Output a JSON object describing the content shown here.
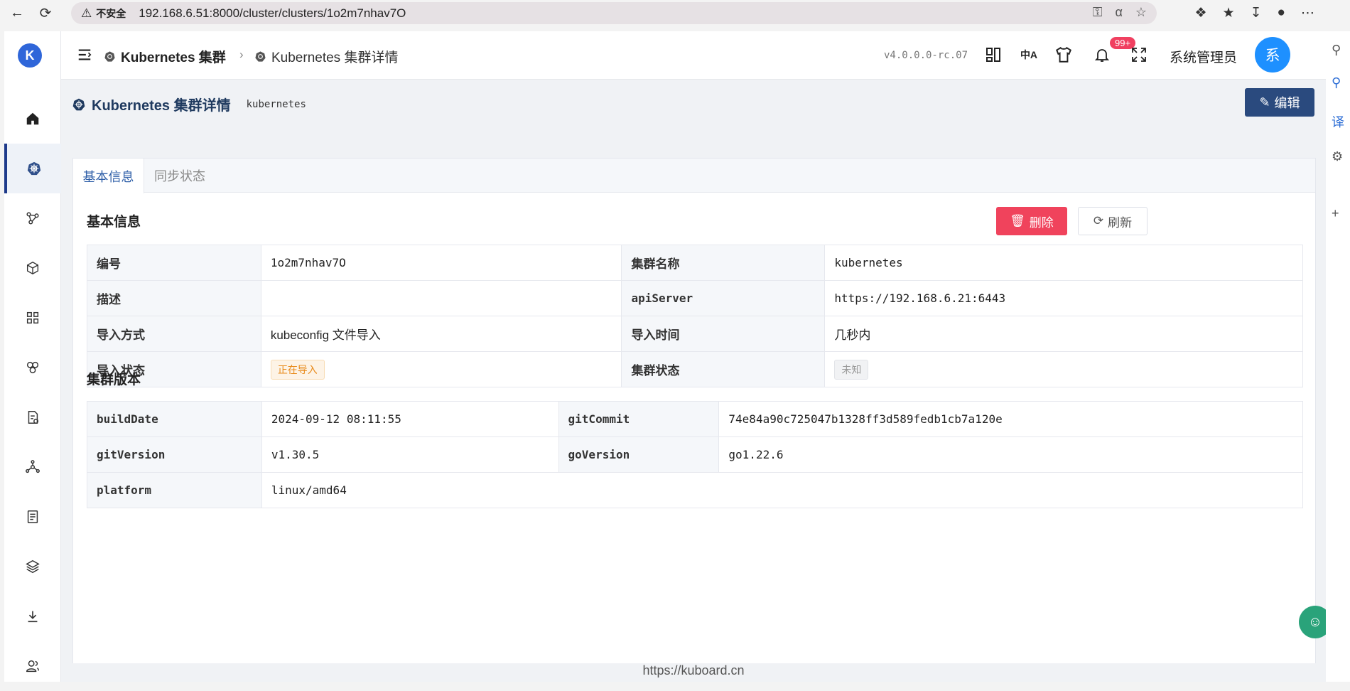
{
  "browser": {
    "insecure_label": "不安全",
    "url": "192.168.6.51:8000/cluster/clusters/1o2m7nhav7O"
  },
  "header": {
    "breadcrumb_1": "Kubernetes 集群",
    "breadcrumb_2": "Kubernetes 集群详情",
    "version": "v4.0.0.0-rc.07",
    "notification_badge": "99+",
    "username": "系统管理员",
    "avatar_letter": "系"
  },
  "sidebar": {
    "logo_letter": "K"
  },
  "page": {
    "title": "Kubernetes 集群详情",
    "subtitle": "kubernetes",
    "edit_label": "编辑"
  },
  "tabs": [
    "基本信息",
    "同步状态"
  ],
  "basic": {
    "section_title": "基本信息",
    "delete_label": "删除",
    "refresh_label": "刷新",
    "rows": [
      {
        "l1": "编号",
        "v1": "1o2m7nhav7O",
        "l2": "集群名称",
        "v2": "kubernetes"
      },
      {
        "l1": "描述",
        "v1": "",
        "l2": "apiServer",
        "v2": "https://192.168.6.21:6443"
      },
      {
        "l1": "导入方式",
        "v1": "kubeconfig 文件导入",
        "l2": "导入时间",
        "v2": "几秒内"
      },
      {
        "l1": "导入状态",
        "v1": "正在导入",
        "l2": "集群状态",
        "v2": "未知"
      }
    ]
  },
  "version_info": {
    "section_title": "集群版本",
    "rows": [
      {
        "l1": "buildDate",
        "v1": "2024-09-12 08:11:55",
        "l2": "gitCommit",
        "v2": "74e84a90c725047b1328ff3d589fedb1cb7a120e"
      },
      {
        "l1": "gitVersion",
        "v1": "v1.30.5",
        "l2": "goVersion",
        "v2": "go1.22.6"
      },
      {
        "l1": "platform",
        "v1": "linux/amd64"
      }
    ]
  },
  "footer": {
    "link": "https://kuboard.cn"
  },
  "colors": {
    "primary": "#2a4a7e",
    "danger": "#f0435c",
    "avatar": "#1e90ff"
  }
}
